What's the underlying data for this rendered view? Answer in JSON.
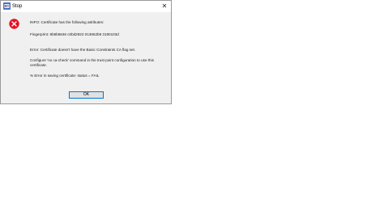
{
  "window": {
    "title": "Stop",
    "close_glyph": "✕",
    "app_icon": "app-icon",
    "message_icon": "error-icon"
  },
  "message": {
    "line1": "INFO: Certificate has the following attributes:",
    "line2": "Fingerprint: 8b5b5846 c0bd2922 013662b8 3190103d",
    "line3": "Error: Certificate doesn't have the Basic Constraints CA flag set.",
    "line4": "Configure 'no ca-check' command in the trust point configuration to use this",
    "line5": "certificate.",
    "line6": "% Error in saving certificate: status = FAIL"
  },
  "buttons": {
    "ok_label": "OK"
  },
  "colors": {
    "error_red": "#e81123",
    "focus_border": "#0078d7",
    "dialog_bg": "#f0f0f0"
  }
}
